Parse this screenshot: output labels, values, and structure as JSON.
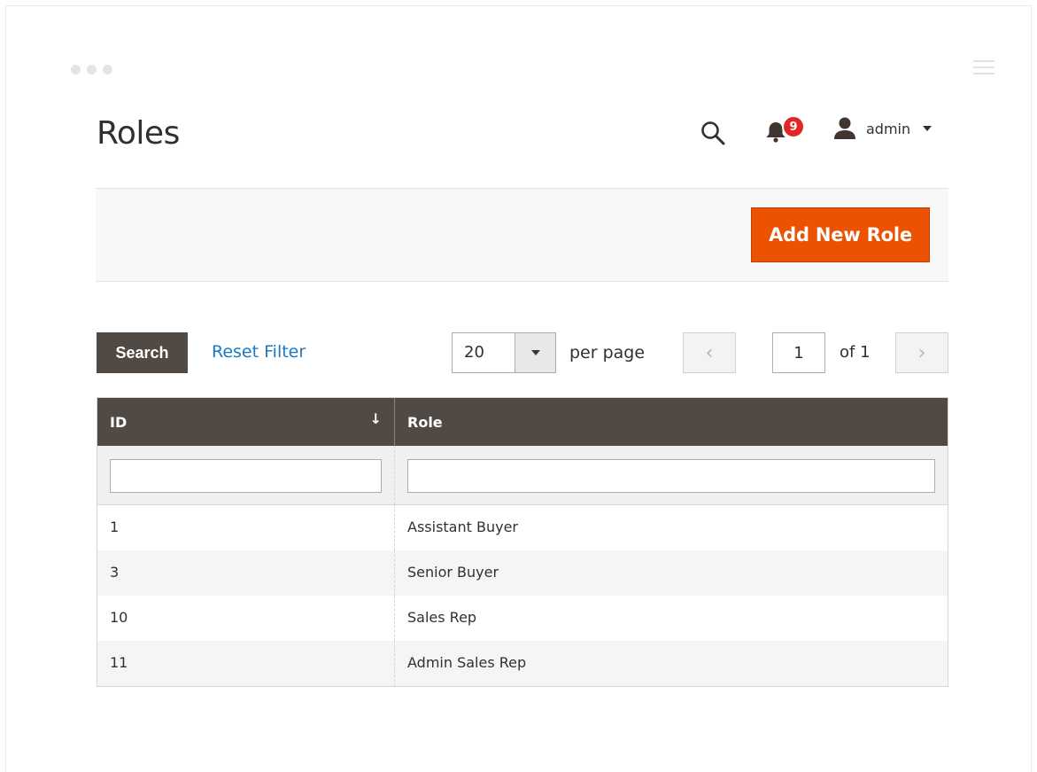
{
  "header": {
    "page_title": "Roles",
    "notifications_count": "9",
    "user_name": "admin"
  },
  "actions": {
    "add_new_role_label": "Add New Role"
  },
  "toolbar": {
    "search_label": "Search",
    "reset_filter_label": "Reset Filter",
    "per_page_value": "20",
    "per_page_label": "per page",
    "current_page": "1",
    "total_pages_label": "of 1",
    "prev_glyph": "‹",
    "next_glyph": "›"
  },
  "grid": {
    "columns": [
      "ID",
      "Role"
    ],
    "sort_glyph": "↓",
    "rows": [
      {
        "id": "1",
        "role": "Assistant Buyer"
      },
      {
        "id": "3",
        "role": "Senior Buyer"
      },
      {
        "id": "10",
        "role": "Sales Rep"
      },
      {
        "id": "11",
        "role": "Admin Sales Rep"
      }
    ]
  },
  "colors": {
    "accent": "#eb5202",
    "header_dark": "#514943",
    "link": "#1979c3",
    "badge": "#e22626"
  },
  "icons": {
    "search": "search-icon",
    "notifications": "bell-icon",
    "user": "user-icon",
    "menu": "hamburger-icon"
  }
}
